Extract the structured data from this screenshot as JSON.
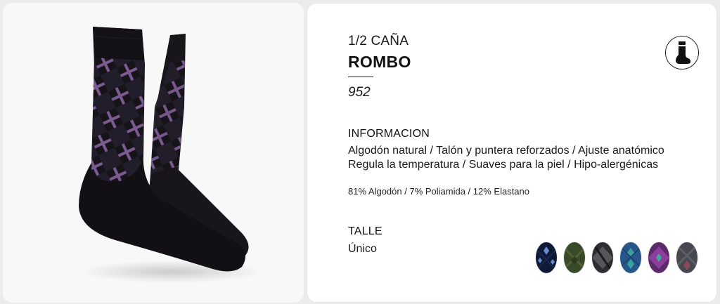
{
  "product": {
    "category": "1/2 CAÑA",
    "name": "ROMBO",
    "code": "952"
  },
  "badge": {
    "icon": "sock-icon"
  },
  "information": {
    "heading": "INFORMACION",
    "line_1": "Algodón natural / Talón y puntera reforzados / Ajuste anatómico",
    "line_2": "Regula la temperatura / Suaves para la piel / Hipo-alergénicas",
    "composition": "81% Algodón / 7% Poliamida / 12% Elastano"
  },
  "size": {
    "heading": "TALLE",
    "value": "Único"
  },
  "colors": {
    "sock_base": "#141216",
    "sock_pattern": "#7a5a8e",
    "swatches": [
      "#101b3a",
      "#3a4a2a",
      "#2e2e33",
      "#2a5a8a",
      "#5a2a6a",
      "#4a4a52"
    ]
  }
}
